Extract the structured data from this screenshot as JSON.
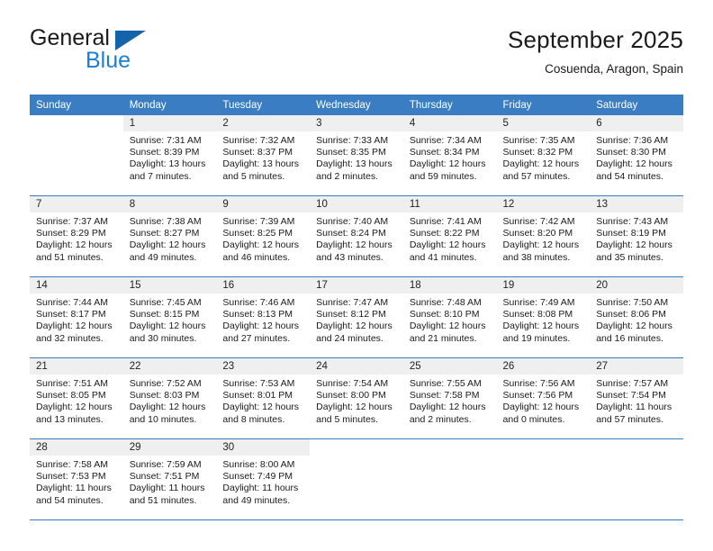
{
  "brand": {
    "name_top": "General",
    "name_bottom": "Blue",
    "triangle_icon": "triangle-icon",
    "colors": {
      "triangle": "#1464aa",
      "blue_text": "#1a7fd4",
      "dark_text": "#1a1a1a"
    }
  },
  "header": {
    "title": "September 2025",
    "subtitle": "Cosuenda, Aragon, Spain"
  },
  "theme": {
    "header_bg": "#3a7dc2",
    "header_text": "#ffffff",
    "daynum_band_bg": "#efefef",
    "cell_bg": "#ffffff",
    "row_rule": "#3a7dc2"
  },
  "weekdays": [
    "Sunday",
    "Monday",
    "Tuesday",
    "Wednesday",
    "Thursday",
    "Friday",
    "Saturday"
  ],
  "weeks": [
    [
      {
        "day": "",
        "sunrise": "",
        "sunset": "",
        "daylight_line1": "",
        "daylight_line2": "",
        "empty": true
      },
      {
        "day": "1",
        "sunrise": "Sunrise: 7:31 AM",
        "sunset": "Sunset: 8:39 PM",
        "daylight_line1": "Daylight: 13 hours",
        "daylight_line2": "and 7 minutes.",
        "empty": false
      },
      {
        "day": "2",
        "sunrise": "Sunrise: 7:32 AM",
        "sunset": "Sunset: 8:37 PM",
        "daylight_line1": "Daylight: 13 hours",
        "daylight_line2": "and 5 minutes.",
        "empty": false
      },
      {
        "day": "3",
        "sunrise": "Sunrise: 7:33 AM",
        "sunset": "Sunset: 8:35 PM",
        "daylight_line1": "Daylight: 13 hours",
        "daylight_line2": "and 2 minutes.",
        "empty": false
      },
      {
        "day": "4",
        "sunrise": "Sunrise: 7:34 AM",
        "sunset": "Sunset: 8:34 PM",
        "daylight_line1": "Daylight: 12 hours",
        "daylight_line2": "and 59 minutes.",
        "empty": false
      },
      {
        "day": "5",
        "sunrise": "Sunrise: 7:35 AM",
        "sunset": "Sunset: 8:32 PM",
        "daylight_line1": "Daylight: 12 hours",
        "daylight_line2": "and 57 minutes.",
        "empty": false
      },
      {
        "day": "6",
        "sunrise": "Sunrise: 7:36 AM",
        "sunset": "Sunset: 8:30 PM",
        "daylight_line1": "Daylight: 12 hours",
        "daylight_line2": "and 54 minutes.",
        "empty": false
      }
    ],
    [
      {
        "day": "7",
        "sunrise": "Sunrise: 7:37 AM",
        "sunset": "Sunset: 8:29 PM",
        "daylight_line1": "Daylight: 12 hours",
        "daylight_line2": "and 51 minutes.",
        "empty": false
      },
      {
        "day": "8",
        "sunrise": "Sunrise: 7:38 AM",
        "sunset": "Sunset: 8:27 PM",
        "daylight_line1": "Daylight: 12 hours",
        "daylight_line2": "and 49 minutes.",
        "empty": false
      },
      {
        "day": "9",
        "sunrise": "Sunrise: 7:39 AM",
        "sunset": "Sunset: 8:25 PM",
        "daylight_line1": "Daylight: 12 hours",
        "daylight_line2": "and 46 minutes.",
        "empty": false
      },
      {
        "day": "10",
        "sunrise": "Sunrise: 7:40 AM",
        "sunset": "Sunset: 8:24 PM",
        "daylight_line1": "Daylight: 12 hours",
        "daylight_line2": "and 43 minutes.",
        "empty": false
      },
      {
        "day": "11",
        "sunrise": "Sunrise: 7:41 AM",
        "sunset": "Sunset: 8:22 PM",
        "daylight_line1": "Daylight: 12 hours",
        "daylight_line2": "and 41 minutes.",
        "empty": false
      },
      {
        "day": "12",
        "sunrise": "Sunrise: 7:42 AM",
        "sunset": "Sunset: 8:20 PM",
        "daylight_line1": "Daylight: 12 hours",
        "daylight_line2": "and 38 minutes.",
        "empty": false
      },
      {
        "day": "13",
        "sunrise": "Sunrise: 7:43 AM",
        "sunset": "Sunset: 8:19 PM",
        "daylight_line1": "Daylight: 12 hours",
        "daylight_line2": "and 35 minutes.",
        "empty": false
      }
    ],
    [
      {
        "day": "14",
        "sunrise": "Sunrise: 7:44 AM",
        "sunset": "Sunset: 8:17 PM",
        "daylight_line1": "Daylight: 12 hours",
        "daylight_line2": "and 32 minutes.",
        "empty": false
      },
      {
        "day": "15",
        "sunrise": "Sunrise: 7:45 AM",
        "sunset": "Sunset: 8:15 PM",
        "daylight_line1": "Daylight: 12 hours",
        "daylight_line2": "and 30 minutes.",
        "empty": false
      },
      {
        "day": "16",
        "sunrise": "Sunrise: 7:46 AM",
        "sunset": "Sunset: 8:13 PM",
        "daylight_line1": "Daylight: 12 hours",
        "daylight_line2": "and 27 minutes.",
        "empty": false
      },
      {
        "day": "17",
        "sunrise": "Sunrise: 7:47 AM",
        "sunset": "Sunset: 8:12 PM",
        "daylight_line1": "Daylight: 12 hours",
        "daylight_line2": "and 24 minutes.",
        "empty": false
      },
      {
        "day": "18",
        "sunrise": "Sunrise: 7:48 AM",
        "sunset": "Sunset: 8:10 PM",
        "daylight_line1": "Daylight: 12 hours",
        "daylight_line2": "and 21 minutes.",
        "empty": false
      },
      {
        "day": "19",
        "sunrise": "Sunrise: 7:49 AM",
        "sunset": "Sunset: 8:08 PM",
        "daylight_line1": "Daylight: 12 hours",
        "daylight_line2": "and 19 minutes.",
        "empty": false
      },
      {
        "day": "20",
        "sunrise": "Sunrise: 7:50 AM",
        "sunset": "Sunset: 8:06 PM",
        "daylight_line1": "Daylight: 12 hours",
        "daylight_line2": "and 16 minutes.",
        "empty": false
      }
    ],
    [
      {
        "day": "21",
        "sunrise": "Sunrise: 7:51 AM",
        "sunset": "Sunset: 8:05 PM",
        "daylight_line1": "Daylight: 12 hours",
        "daylight_line2": "and 13 minutes.",
        "empty": false
      },
      {
        "day": "22",
        "sunrise": "Sunrise: 7:52 AM",
        "sunset": "Sunset: 8:03 PM",
        "daylight_line1": "Daylight: 12 hours",
        "daylight_line2": "and 10 minutes.",
        "empty": false
      },
      {
        "day": "23",
        "sunrise": "Sunrise: 7:53 AM",
        "sunset": "Sunset: 8:01 PM",
        "daylight_line1": "Daylight: 12 hours",
        "daylight_line2": "and 8 minutes.",
        "empty": false
      },
      {
        "day": "24",
        "sunrise": "Sunrise: 7:54 AM",
        "sunset": "Sunset: 8:00 PM",
        "daylight_line1": "Daylight: 12 hours",
        "daylight_line2": "and 5 minutes.",
        "empty": false
      },
      {
        "day": "25",
        "sunrise": "Sunrise: 7:55 AM",
        "sunset": "Sunset: 7:58 PM",
        "daylight_line1": "Daylight: 12 hours",
        "daylight_line2": "and 2 minutes.",
        "empty": false
      },
      {
        "day": "26",
        "sunrise": "Sunrise: 7:56 AM",
        "sunset": "Sunset: 7:56 PM",
        "daylight_line1": "Daylight: 12 hours",
        "daylight_line2": "and 0 minutes.",
        "empty": false
      },
      {
        "day": "27",
        "sunrise": "Sunrise: 7:57 AM",
        "sunset": "Sunset: 7:54 PM",
        "daylight_line1": "Daylight: 11 hours",
        "daylight_line2": "and 57 minutes.",
        "empty": false
      }
    ],
    [
      {
        "day": "28",
        "sunrise": "Sunrise: 7:58 AM",
        "sunset": "Sunset: 7:53 PM",
        "daylight_line1": "Daylight: 11 hours",
        "daylight_line2": "and 54 minutes.",
        "empty": false
      },
      {
        "day": "29",
        "sunrise": "Sunrise: 7:59 AM",
        "sunset": "Sunset: 7:51 PM",
        "daylight_line1": "Daylight: 11 hours",
        "daylight_line2": "and 51 minutes.",
        "empty": false
      },
      {
        "day": "30",
        "sunrise": "Sunrise: 8:00 AM",
        "sunset": "Sunset: 7:49 PM",
        "daylight_line1": "Daylight: 11 hours",
        "daylight_line2": "and 49 minutes.",
        "empty": false
      },
      {
        "day": "",
        "sunrise": "",
        "sunset": "",
        "daylight_line1": "",
        "daylight_line2": "",
        "empty": true
      },
      {
        "day": "",
        "sunrise": "",
        "sunset": "",
        "daylight_line1": "",
        "daylight_line2": "",
        "empty": true
      },
      {
        "day": "",
        "sunrise": "",
        "sunset": "",
        "daylight_line1": "",
        "daylight_line2": "",
        "empty": true
      },
      {
        "day": "",
        "sunrise": "",
        "sunset": "",
        "daylight_line1": "",
        "daylight_line2": "",
        "empty": true
      }
    ]
  ]
}
